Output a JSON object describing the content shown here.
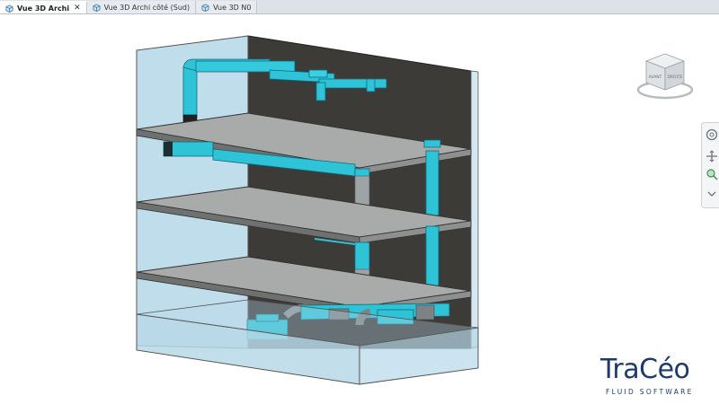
{
  "tabs": [
    {
      "label": "Vue 3D Archi",
      "active": true,
      "closable": true,
      "icon": "3d-view-icon"
    },
    {
      "label": "Vue 3D Archi côté (Sud)",
      "active": false,
      "closable": false,
      "icon": "3d-view-icon"
    },
    {
      "label": "Vue 3D N0",
      "active": false,
      "closable": false,
      "icon": "3d-view-icon"
    }
  ],
  "viewcube": {
    "front_label": "AVANT",
    "right_label": "DROITE"
  },
  "navigation_bar": {
    "buttons": [
      "steering-wheel-icon",
      "pan-icon",
      "zoom-icon"
    ]
  },
  "logo": {
    "main_a": "Tra",
    "main_b": "C",
    "main_c": "éo",
    "sub": "FLUID SOFTWARE"
  },
  "colors": {
    "duct": "#2ec3d6",
    "duct_dark": "#138fa3",
    "glass": "#b7d8e8",
    "back_wall": "#3d3b38",
    "slab": "#a9aaaa",
    "logo": "#1d3a6e",
    "logo_accent": "#1aa6c9"
  }
}
